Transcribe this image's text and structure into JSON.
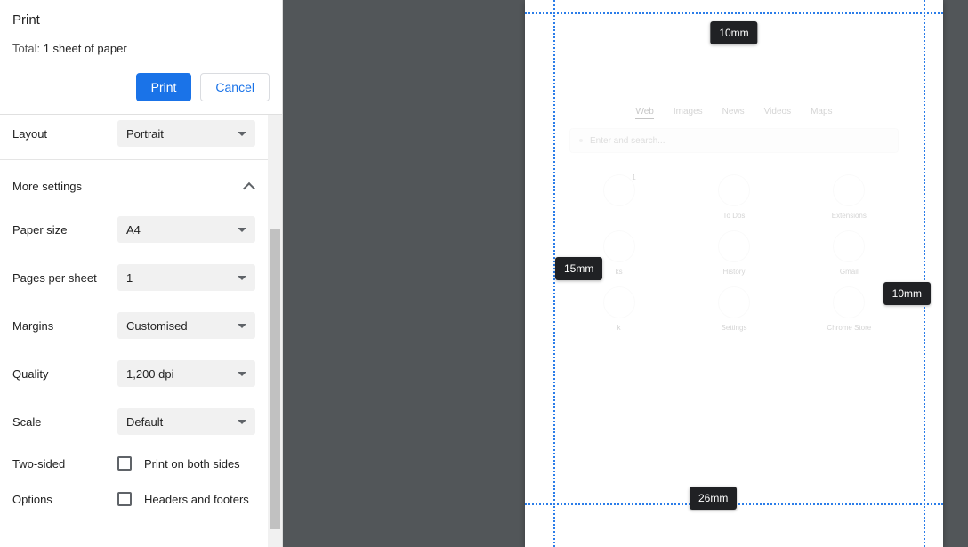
{
  "header": {
    "title": "Print",
    "total_prefix": "Total: ",
    "total_value": "1 sheet of paper",
    "print_btn": "Print",
    "cancel_btn": "Cancel"
  },
  "settings": {
    "layout_label": "Layout",
    "layout_value": "Portrait",
    "more_label": "More settings",
    "paper_label": "Paper size",
    "paper_value": "A4",
    "pps_label": "Pages per sheet",
    "pps_value": "1",
    "margins_label": "Margins",
    "margins_value": "Customised",
    "quality_label": "Quality",
    "quality_value": "1,200 dpi",
    "scale_label": "Scale",
    "scale_value": "Default",
    "twosided_label": "Two-sided",
    "twosided_text": "Print on both sides",
    "options_label": "Options",
    "options_text": "Headers and footers"
  },
  "margins": {
    "top": "10mm",
    "left": "15mm",
    "right": "10mm",
    "bottom": "26mm"
  },
  "preview": {
    "tabs": [
      "Web",
      "Images",
      "News",
      "Videos",
      "Maps"
    ],
    "search_placeholder": "Enter and search...",
    "tiles": [
      "",
      "To Dos",
      "Extensions",
      "ks",
      "History",
      "Gmail",
      "k",
      "Settings",
      "Chrome Store"
    ],
    "badge": "1"
  }
}
